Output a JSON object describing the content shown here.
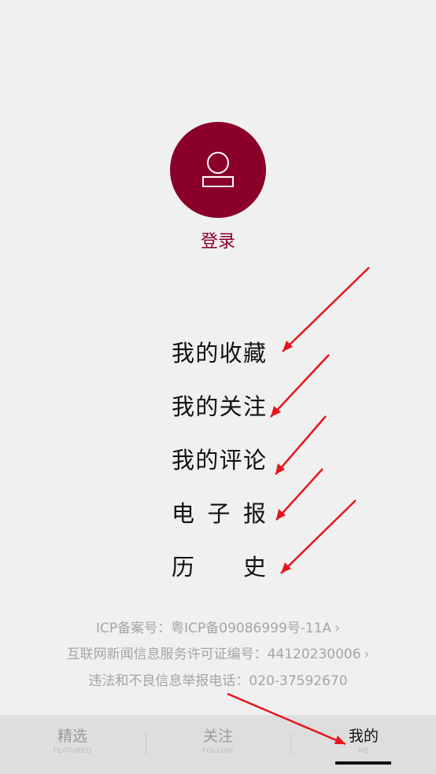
{
  "profile": {
    "avatar_icon": "user-icon",
    "login_label": "登录",
    "accent_color": "#8b0028"
  },
  "menu": {
    "items": [
      {
        "label": "我的收藏"
      },
      {
        "label": "我的关注"
      },
      {
        "label": "我的评论"
      },
      {
        "label": "电子报"
      },
      {
        "label": "历史"
      }
    ]
  },
  "footer": {
    "icp_label": "ICP备案号：粤ICP备09086999号-11A",
    "license_label": "互联网新闻信息服务许可证编号：44120230006",
    "report_label": "违法和不良信息举报电话：020-37592670",
    "chevron": "›"
  },
  "tabbar": {
    "tabs": [
      {
        "label": "精选",
        "sub": "FEATURED"
      },
      {
        "label": "关注",
        "sub": "FOLLOW"
      },
      {
        "label": "我的",
        "sub": "ME"
      }
    ],
    "active_index": 2
  },
  "annotation": {
    "arrow_color": "#e8151c"
  }
}
